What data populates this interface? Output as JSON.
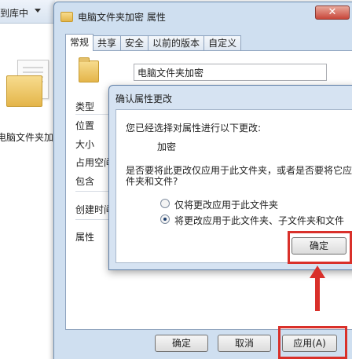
{
  "explorer": {
    "breadcrumb": "到库中",
    "folder_label": "电脑文件夹加密"
  },
  "properties_window": {
    "title": "电脑文件夹加密 属性",
    "close_label": "✕",
    "tabs": [
      "常规",
      "共享",
      "安全",
      "以前的版本",
      "自定义"
    ],
    "folder_name": "电脑文件夹加密",
    "labels": [
      "类型",
      "位置",
      "大小",
      "占用空间",
      "包含",
      "创建时间",
      "属性"
    ],
    "buttons": {
      "ok": "确定",
      "cancel": "取消",
      "apply": "应用(A)"
    }
  },
  "confirm_dialog": {
    "title": "确认属性更改",
    "intro": "您已经选择对属性进行以下更改:",
    "change": "加密",
    "question_line1": "是否要将此更改仅应用于此文件夹，或者是否要将它应用",
    "question_line2": "件夹和文件?",
    "options": [
      "仅将更改应用于此文件夹",
      "将更改应用于此文件夹、子文件夹和文件"
    ],
    "selected_option": 1,
    "ok_label": "确定"
  },
  "annotation_color": "#d9302a"
}
